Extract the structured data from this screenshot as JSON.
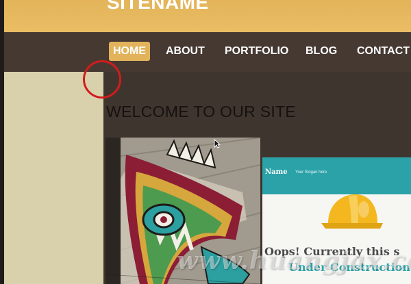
{
  "header": {
    "site_name": "SITENAME"
  },
  "nav": {
    "items": [
      {
        "label": "HOME",
        "active": true
      },
      {
        "label": "ABOUT",
        "active": false
      },
      {
        "label": "PORTFOLIO",
        "active": false
      },
      {
        "label": "BLOG",
        "active": false
      },
      {
        "label": "CONTACT",
        "active": false
      }
    ]
  },
  "main": {
    "heading": "WELCOME TO OUR SITE"
  },
  "thumbnail": {
    "name": "Name",
    "slogan": "Your Slogan here",
    "message_line1": "Oops! Currently this s",
    "message_line2": "Under Construction"
  },
  "watermark": {
    "text": "www.huangjax.com"
  },
  "colors": {
    "header_gold": "#e8b961",
    "nav_brown": "#463932",
    "active_tab": "#e2b35a",
    "sidebar_beige": "#d8d1ac",
    "annotation_red": "#d21c1c",
    "thumb_teal": "#2ba2a8"
  },
  "icons": {
    "cursor": "arrow-cursor-icon",
    "hardhat": "hard-hat-icon"
  }
}
